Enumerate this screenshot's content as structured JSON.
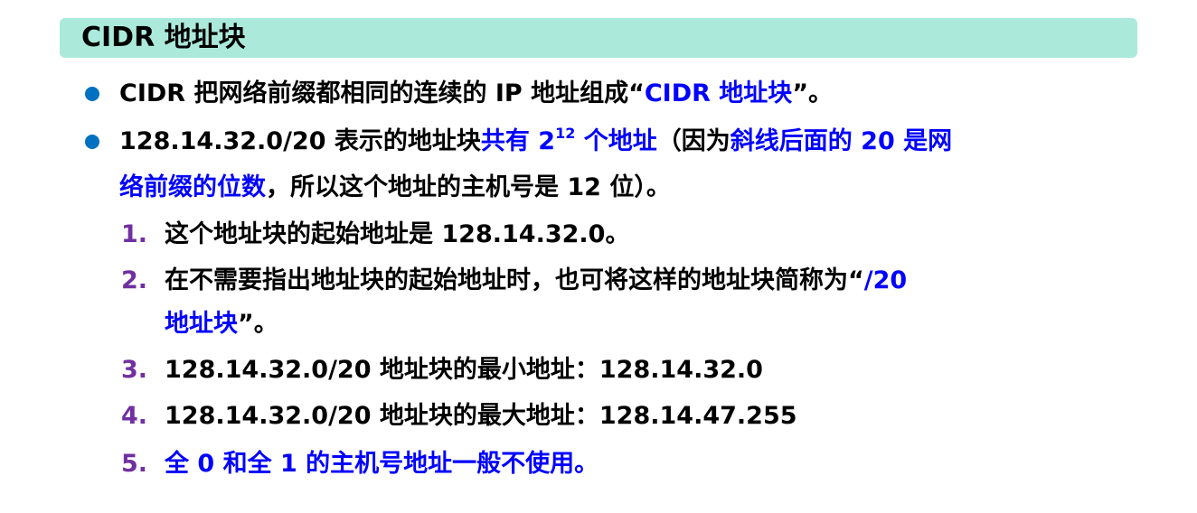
{
  "title": "CIDR 地址块",
  "colors": {
    "title_bg": "#abeadb",
    "bullet": "#0070c0",
    "number": "#7030a0",
    "highlight": "#0000ff"
  },
  "bullets": [
    {
      "icon": "filled-circle",
      "segments": [
        "CIDR 把网络前缀都相同的连续的 IP 地址组成“",
        "CIDR 地址块",
        "”。"
      ]
    },
    {
      "icon": "filled-circle",
      "line1": [
        "128.14.32.0/20 表示的地址块",
        "共有 2",
        "12",
        " 个地址",
        "（因为",
        "斜线后面的 20 是网"
      ],
      "line2": [
        "络前缀的位数",
        "，所以这个地址的主机号是 12 位）。"
      ]
    }
  ],
  "numbered": [
    {
      "num": "1.",
      "text": "这个地址块的起始地址是 128.14.32.0。"
    },
    {
      "num": "2.",
      "line1": [
        "在不需要指出地址块的起始地址时，也可将这样的地址块简称为“",
        "/20"
      ],
      "line2": [
        "地址块",
        "”。"
      ]
    },
    {
      "num": "3.",
      "text": "128.14.32.0/20 地址块的最小地址：128.14.32.0"
    },
    {
      "num": "4.",
      "text": "128.14.32.0/20 地址块的最大地址：128.14.47.255"
    },
    {
      "num": "5.",
      "text": "全 0 和全 1 的主机号地址一般不使用。"
    }
  ]
}
